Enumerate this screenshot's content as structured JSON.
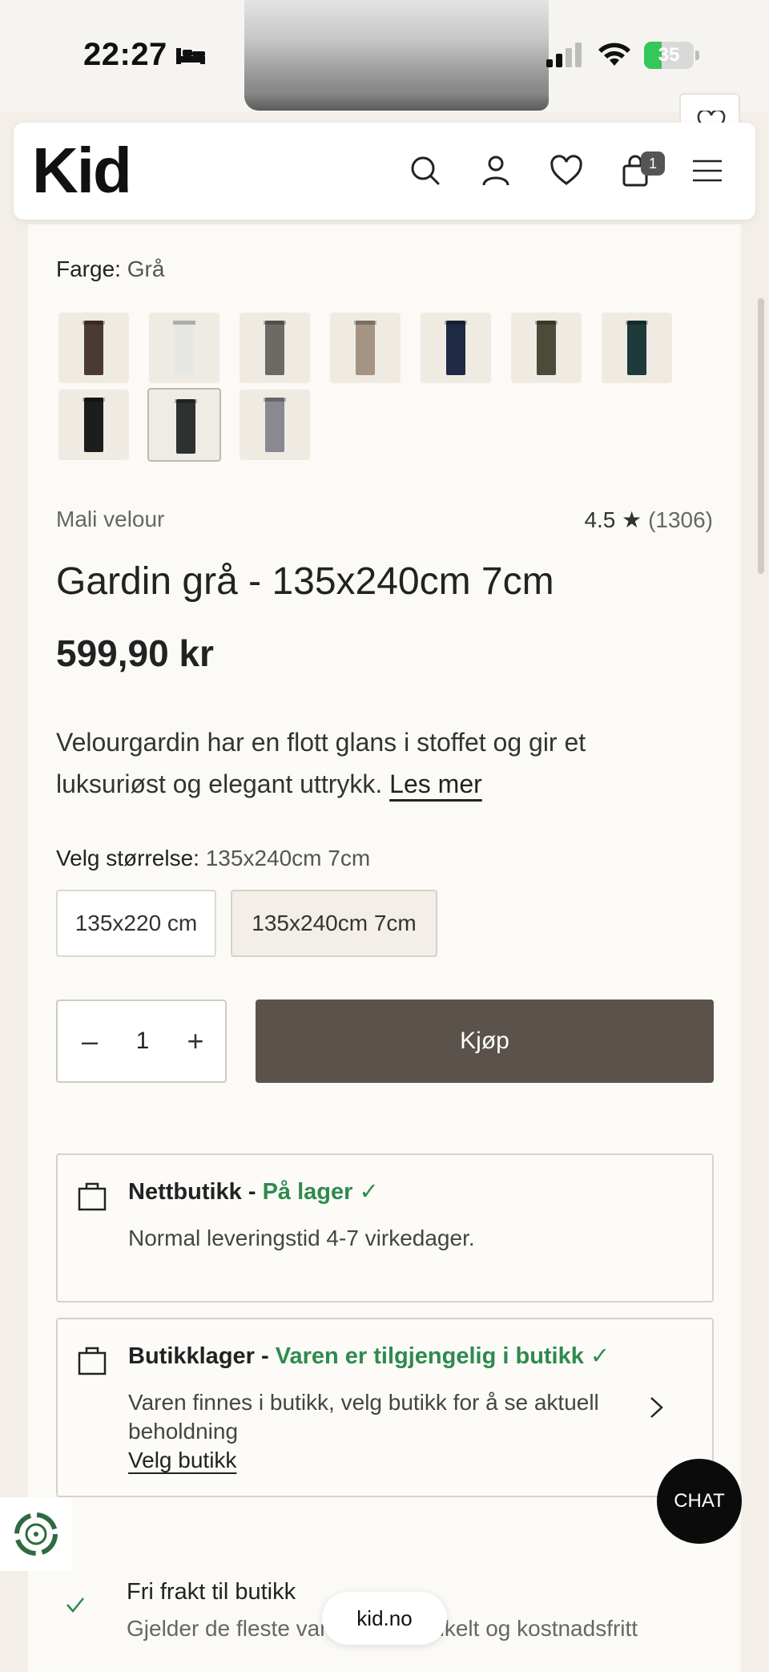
{
  "status_bar": {
    "time": "22:27",
    "battery": "35",
    "battery_level": 0.35
  },
  "header": {
    "logo": "Kid",
    "cart_count": "1"
  },
  "product": {
    "color_label": "Farge:",
    "color_value": "Grå",
    "swatches": [
      {
        "name": "brown",
        "color": "#4a3a32"
      },
      {
        "name": "white",
        "color": "#e6e6e4"
      },
      {
        "name": "grey",
        "color": "#6d6a66"
      },
      {
        "name": "beige",
        "color": "#a59383"
      },
      {
        "name": "navy",
        "color": "#1f2a44"
      },
      {
        "name": "olive",
        "color": "#4b4b3a"
      },
      {
        "name": "teal",
        "color": "#1f3a3a"
      },
      {
        "name": "black",
        "color": "#1d1d1d"
      },
      {
        "name": "dark-grey",
        "color": "#2f3130"
      },
      {
        "name": "light-grey",
        "color": "#8a8890"
      }
    ],
    "brand": "Mali velour",
    "rating": "4.5",
    "rating_star": "★",
    "rating_count": "(1306)",
    "title": "Gardin grå - 135x240cm 7cm",
    "price": "599,90 kr",
    "description": "Velourgardin har en flott glans i stoffet og gir et luksuriøst og elegant uttrykk.",
    "read_more": "Les mer",
    "size_label": "Velg størrelse:",
    "size_value": "135x240cm 7cm",
    "sizes": [
      "135x220 cm",
      "135x240cm 7cm"
    ],
    "quantity": "1",
    "qty_minus": "–",
    "qty_plus": "+",
    "buy_label": "Kjøp"
  },
  "stock": {
    "online_title": "Nettbutikk - ",
    "online_status": "På lager ✓",
    "online_text": "Normal leveringstid 4-7 virkedager.",
    "store_title": "Butikklager - ",
    "store_status": "Varen er tilgjengelig i butikk ✓",
    "store_text": "Varen finnes i butikk, velg butikk for å se aktuell beholdning",
    "store_link": "Velg butikk"
  },
  "chat_label": "CHAT",
  "usp": {
    "title": "Fri frakt til butikk",
    "subtitle": "Gjelder de fleste varer, raskt, enkelt og kostnadsfritt"
  },
  "browser_url": "kid.no"
}
